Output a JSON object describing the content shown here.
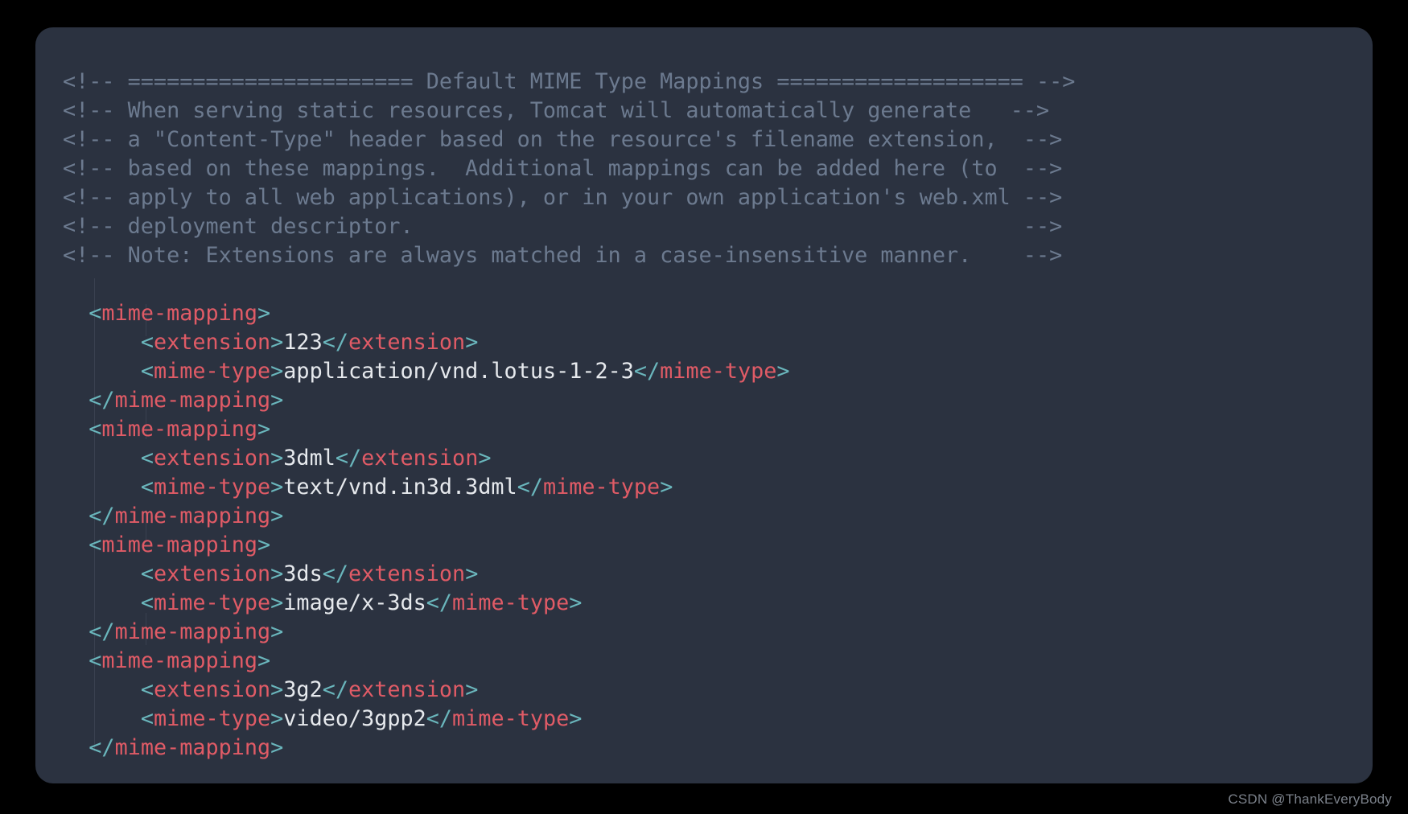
{
  "comments": {
    "l1": "<!-- ====================== Default MIME Type Mappings =================== -->",
    "l2": "<!-- When serving static resources, Tomcat will automatically generate   -->",
    "l3": "<!-- a \"Content-Type\" header based on the resource's filename extension,  -->",
    "l4": "<!-- based on these mappings.  Additional mappings can be added here (to  -->",
    "l5": "<!-- apply to all web applications), or in your own application's web.xml -->",
    "l6": "<!-- deployment descriptor.                                               -->",
    "l7": "<!-- Note: Extensions are always matched in a case-insensitive manner.    -->"
  },
  "tags": {
    "mime_mapping": "mime-mapping",
    "extension": "extension",
    "mime_type": "mime-type"
  },
  "mappings": [
    {
      "extension": "123",
      "mime_type": "application/vnd.lotus-1-2-3"
    },
    {
      "extension": "3dml",
      "mime_type": "text/vnd.in3d.3dml"
    },
    {
      "extension": "3ds",
      "mime_type": "image/x-3ds"
    },
    {
      "extension": "3g2",
      "mime_type": "video/3gpp2"
    }
  ],
  "punct": {
    "lt": "<",
    "gt": ">",
    "lts": "</",
    "sp1": "  ",
    "sp2": "      "
  },
  "watermark": "CSDN @ThankEveryBody"
}
